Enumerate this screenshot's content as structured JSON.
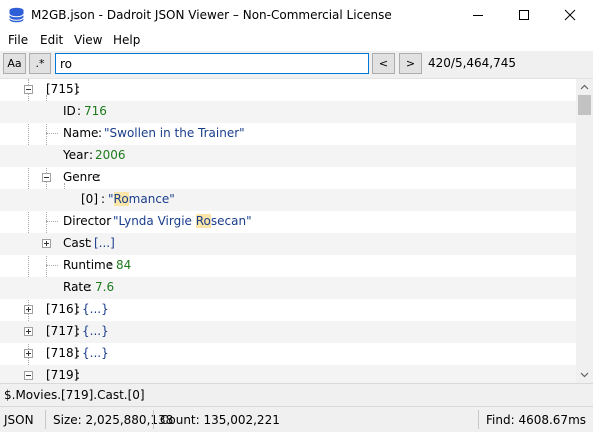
{
  "window": {
    "title": "M2GB.json - Dadroit JSON Viewer – Non-Commercial License",
    "icons": [
      "app-database-icon",
      "minimize-icon",
      "maximize-icon",
      "close-icon"
    ]
  },
  "menu": [
    "File",
    "Edit",
    "View",
    "Help"
  ],
  "toolbar": {
    "case_button": "Aa",
    "regex_button": ".*",
    "search_value": "ro",
    "prev_label": "<",
    "next_label": ">",
    "match_count": "420/5,464,745"
  },
  "tree": {
    "node_715": "[715]",
    "id_key": "ID",
    "id_value": "716",
    "name_key": "Name",
    "name_value_pre": "\"Swollen in the Trainer\"",
    "year_key": "Year",
    "year_value": "2006",
    "genre_key": "Genre",
    "genre0_key": "[0]",
    "genre0_q": "\"",
    "genre0_hl": "Ro",
    "genre0_rest": "mance\"",
    "director_key": "Director",
    "director_pre": "\"Lynda Virgie ",
    "director_hl": "Ro",
    "director_rest": "secan\"",
    "cast_key": "Cast",
    "cast_value": "[...]",
    "runtime_key": "Runtime",
    "runtime_value": "84",
    "rate_key": "Rate",
    "rate_value": "7.6",
    "node_716": "[716]",
    "node_717": "[717]",
    "node_718": "[718]",
    "node_719": "[719]",
    "obj_collapsed": "{...}",
    "colon": ":"
  },
  "path": "$.Movies.[719].Cast.[0]",
  "status": {
    "format": "JSON",
    "size": "Size: 2,025,880,138",
    "count": "Count: 135,002,221",
    "find": "Find: 4608.67ms"
  }
}
